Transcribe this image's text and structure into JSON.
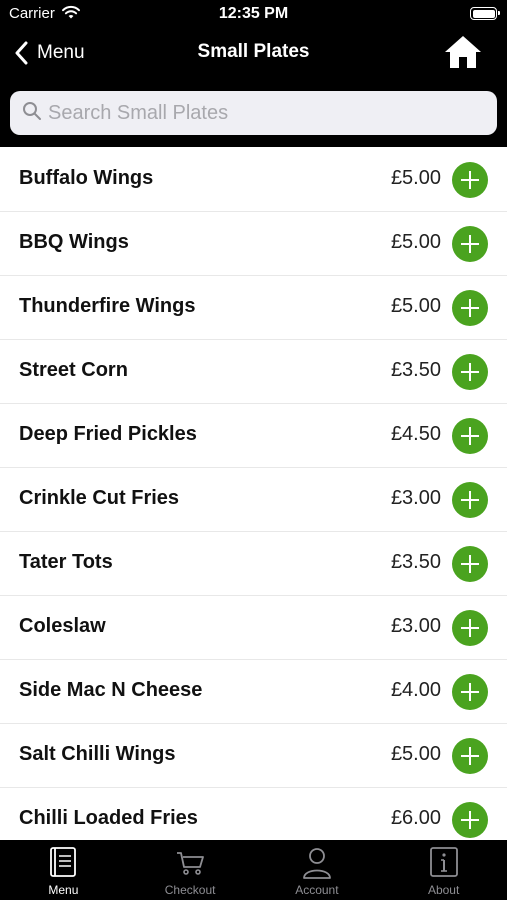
{
  "status_bar": {
    "carrier": "Carrier",
    "time": "12:35 PM"
  },
  "nav": {
    "back_label": "Menu",
    "title": "Small Plates",
    "home_icon": "home-icon"
  },
  "search": {
    "placeholder": "Search Small Plates",
    "value": ""
  },
  "items": [
    {
      "name": "Buffalo Wings",
      "price": "£5.00"
    },
    {
      "name": "BBQ Wings",
      "price": "£5.00"
    },
    {
      "name": "Thunderfire Wings",
      "price": "£5.00"
    },
    {
      "name": "Street Corn",
      "price": "£3.50"
    },
    {
      "name": "Deep Fried Pickles",
      "price": "£4.50"
    },
    {
      "name": "Crinkle Cut Fries",
      "price": "£3.00"
    },
    {
      "name": "Tater Tots",
      "price": "£3.50"
    },
    {
      "name": "Coleslaw",
      "price": "£3.00"
    },
    {
      "name": "Side Mac N Cheese",
      "price": "£4.00"
    },
    {
      "name": "Salt Chilli Wings",
      "price": "£5.00"
    },
    {
      "name": "Chilli Loaded Fries",
      "price": "£6.00"
    }
  ],
  "tabs": [
    {
      "label": "Menu",
      "icon": "menu-book-icon",
      "active": true
    },
    {
      "label": "Checkout",
      "icon": "cart-icon",
      "active": false
    },
    {
      "label": "Account",
      "icon": "person-icon",
      "active": false
    },
    {
      "label": "About",
      "icon": "info-icon",
      "active": false
    }
  ],
  "colors": {
    "header_bg": "#000000",
    "add_button": "#4aa31f",
    "tab_active": "#ffffff",
    "tab_inactive": "#8e8e93"
  }
}
